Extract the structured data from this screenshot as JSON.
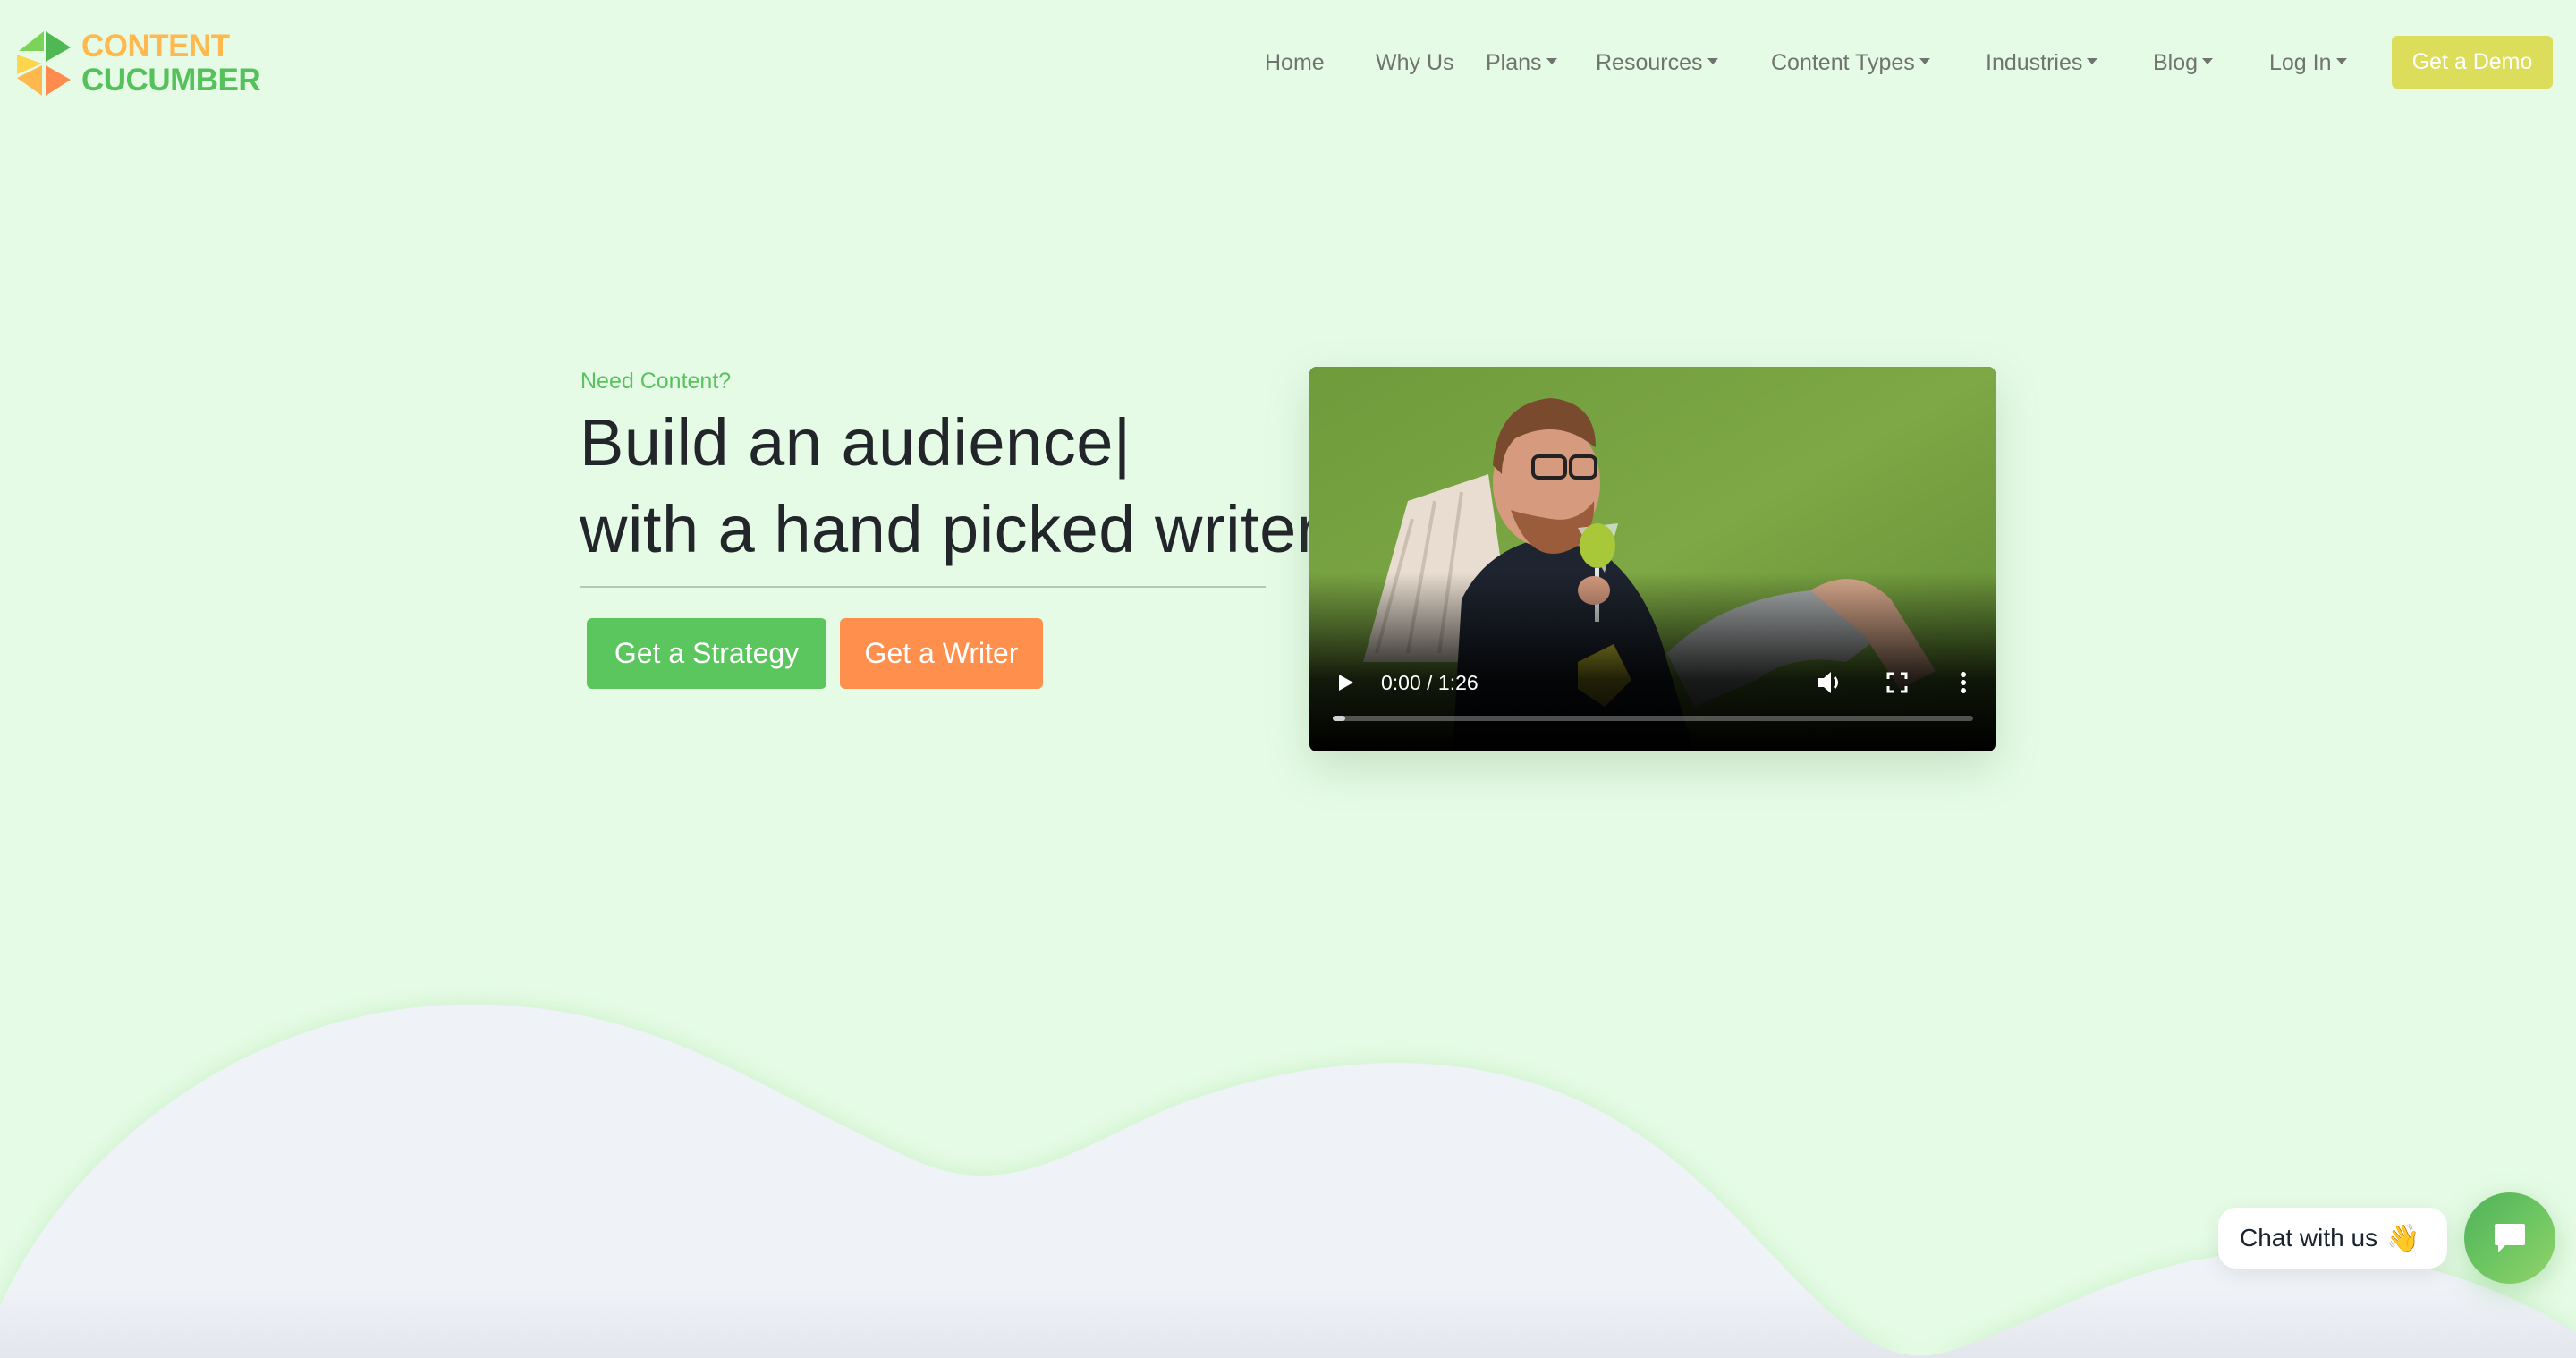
{
  "brand": {
    "line1": "CONTENT",
    "line2": "CUCUMBER",
    "colors": {
      "orange": "#ffb84d",
      "green": "#55c15a"
    }
  },
  "nav": {
    "items": [
      {
        "label": "Home",
        "dropdown": false
      },
      {
        "label": "Why Us",
        "dropdown": false
      },
      {
        "label": "Plans",
        "dropdown": true
      },
      {
        "label": "Resources",
        "dropdown": true
      },
      {
        "label": "Content Types",
        "dropdown": true
      },
      {
        "label": "Industries",
        "dropdown": true
      },
      {
        "label": "Blog",
        "dropdown": true
      },
      {
        "label": "Log In",
        "dropdown": true
      }
    ],
    "cta_label": "Get a Demo"
  },
  "hero": {
    "eyebrow": "Need Content?",
    "headline_line1": "Build an audience",
    "typing_cursor": "|",
    "headline_line2": "with a hand picked writer.",
    "primary_button": "Get a Strategy",
    "secondary_button": "Get a Writer"
  },
  "video": {
    "time_display": "0:00 / 1:26",
    "current_time": "0:00",
    "duration": "1:26",
    "progress_fraction": 0.02,
    "icons": [
      "play-icon",
      "volume-icon",
      "fullscreen-icon",
      "more-options-icon"
    ]
  },
  "chat": {
    "label": "Chat with us",
    "emoji": "👋",
    "icon": "chat-bubble-icon"
  },
  "theme": {
    "background": "#e6fbe6",
    "accent_green": "#5bc65d",
    "accent_orange": "#ff8f4d",
    "demo_yellow": "#dcdd5a",
    "wave_gray": "#eff2f7"
  }
}
